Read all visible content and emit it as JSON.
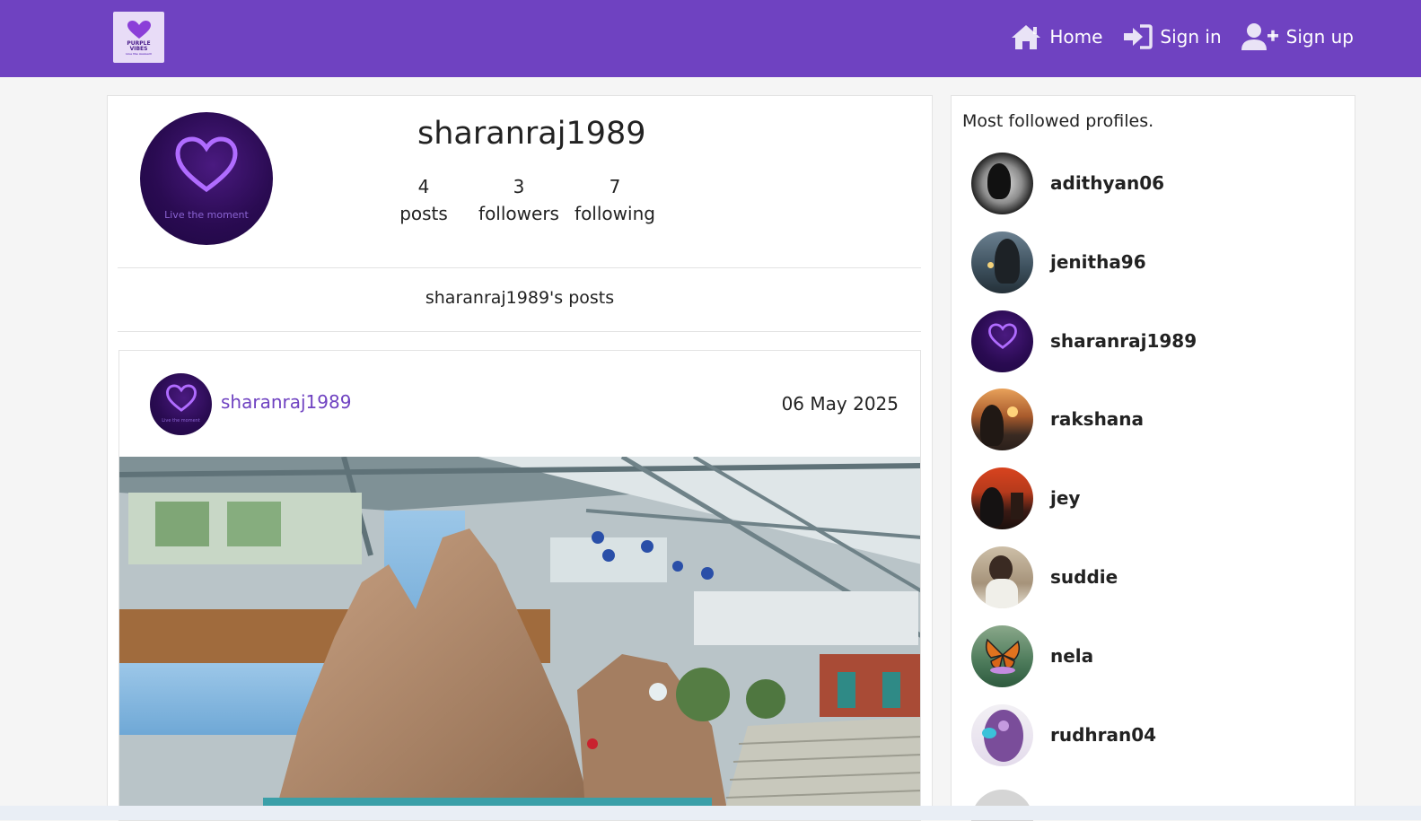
{
  "colors": {
    "navbar": "#6f42c1",
    "accent": "#6f42c1",
    "background": "#f5f5f5"
  },
  "logo": {
    "line1": "PURPLE",
    "line2": "VIBES",
    "line3": "Live the moment"
  },
  "nav": {
    "home": {
      "label": "Home",
      "icon": "home-icon"
    },
    "signin": {
      "label": "Sign in",
      "icon": "sign-in-icon"
    },
    "signup": {
      "label": "Sign up",
      "icon": "user-plus-icon"
    }
  },
  "profile": {
    "username": "sharanraj1989",
    "avatar_tagline": "Live the moment",
    "stats": [
      {
        "value": "4",
        "label": "posts"
      },
      {
        "value": "3",
        "label": "followers"
      },
      {
        "value": "7",
        "label": "following"
      }
    ],
    "posts_heading": "sharanraj1989's posts"
  },
  "post": {
    "username": "sharanraj1989",
    "avatar_tagline": "Live the moment",
    "date": "06 May 2025"
  },
  "sidebar": {
    "title": "Most followed profiles.",
    "profiles": [
      {
        "name": "adithyan06"
      },
      {
        "name": "jenitha96"
      },
      {
        "name": "sharanraj1989"
      },
      {
        "name": "rakshana"
      },
      {
        "name": "jey"
      },
      {
        "name": "suddie"
      },
      {
        "name": "nela"
      },
      {
        "name": "rudhran04"
      }
    ]
  }
}
